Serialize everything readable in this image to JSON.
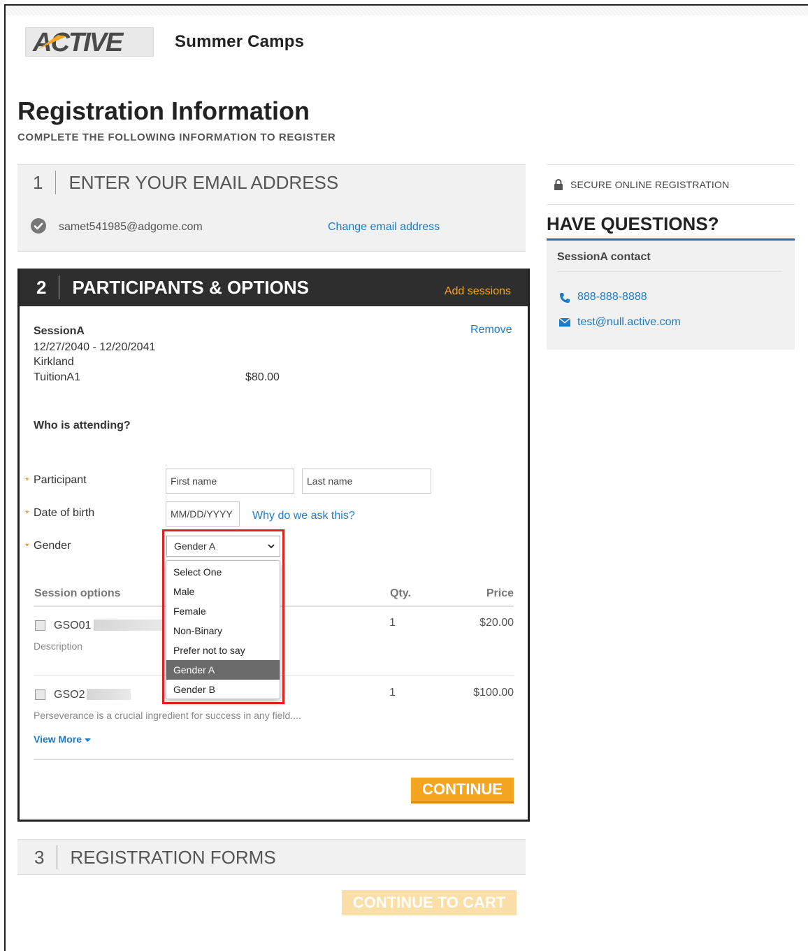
{
  "header": {
    "logo_text": "ACTIVE",
    "brand_title": "Summer Camps"
  },
  "page": {
    "title": "Registration Information",
    "subtitle": "COMPLETE THE FOLLOWING INFORMATION TO REGISTER"
  },
  "step1": {
    "number": "1",
    "title": "ENTER YOUR EMAIL ADDRESS",
    "email": "samet541985@adgome.com",
    "change_link": "Change email address"
  },
  "step2": {
    "number": "2",
    "title": "PARTICIPANTS & OPTIONS",
    "add_sessions": "Add sessions",
    "session": {
      "name": "SessionA",
      "dates": "12/27/2040 - 12/20/2041",
      "location": "Kirkland",
      "tuition": "TuitionA1",
      "tuition_price": "$80.00",
      "remove": "Remove"
    },
    "who_attending": "Who is attending?",
    "required_mark": "*",
    "fields": {
      "participant_label": "Participant",
      "first_name_placeholder": "First name",
      "last_name_placeholder": "Last name",
      "dob_label": "Date of birth",
      "dob_placeholder": "MM/DD/YYYY",
      "why_link": "Why do we ask this?",
      "gender_label": "Gender",
      "gender_value": "Gender A",
      "gender_options": [
        "Select One",
        "Male",
        "Female",
        "Non-Binary",
        "Prefer not to say",
        "Gender A",
        "Gender B"
      ]
    },
    "options": {
      "headers": {
        "name": "Session options",
        "qty": "Qty.",
        "price": "Price"
      },
      "items": [
        {
          "code": "GSO01",
          "description": "Description",
          "qty": "1",
          "price": "$20.00"
        },
        {
          "code": "GSO2",
          "description": "Perseverance is a crucial ingredient for success in any field....",
          "qty": "1",
          "price": "$100.00"
        }
      ],
      "view_more": "View More"
    },
    "continue": "CONTINUE"
  },
  "step3": {
    "number": "3",
    "title": "REGISTRATION FORMS",
    "continue_cart": "CONTINUE TO CART"
  },
  "sidebar": {
    "secure": "SECURE ONLINE REGISTRATION",
    "have_questions": "HAVE QUESTIONS?",
    "contact_title": "SessionA contact",
    "phone": "888-888-8888",
    "email": "test@null.active.com"
  },
  "colors": {
    "accent": "#f4a522",
    "link": "#1d7bc8",
    "dark_bar": "#2e2e2e",
    "highlight": "#e21e1e"
  }
}
